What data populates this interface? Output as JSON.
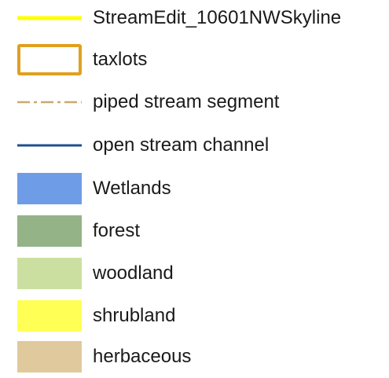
{
  "legend": {
    "items": [
      {
        "label": "StreamEdit_10601NWSkyline",
        "symbol": "line",
        "color": "#ffff00"
      },
      {
        "label": "taxlots",
        "symbol": "outline-box",
        "color": "#e0a020"
      },
      {
        "label": "piped stream segment",
        "symbol": "dash-dot-line",
        "color": "#c8aa6e"
      },
      {
        "label": "open stream channel",
        "symbol": "line",
        "color": "#1f4f8f"
      },
      {
        "label": "Wetlands",
        "symbol": "fill",
        "color": "#6f9ce6"
      },
      {
        "label": "forest",
        "symbol": "fill",
        "color": "#94b386"
      },
      {
        "label": "woodland",
        "symbol": "fill",
        "color": "#cbe0a0"
      },
      {
        "label": "shrubland",
        "symbol": "fill",
        "color": "#ffff55"
      },
      {
        "label": "herbaceous",
        "symbol": "fill",
        "color": "#e0c99c"
      }
    ]
  }
}
